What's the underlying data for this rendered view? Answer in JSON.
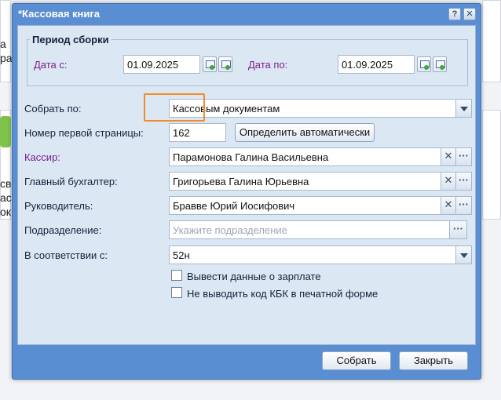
{
  "dialog": {
    "title": "*Кассовая книга",
    "help_button": "?",
    "close_button": "✕"
  },
  "period": {
    "legend": "Период сборки",
    "date_from_label": "Дата с:",
    "date_from_value": "01.09.2025",
    "date_to_label": "Дата по:",
    "date_to_value": "01.09.2025"
  },
  "form": {
    "collect_by_label": "Собрать по:",
    "collect_by_value": "Кассовым документам",
    "first_page_label": "Номер первой страницы:",
    "first_page_value": "162",
    "auto_detect_button": "Определить автоматически",
    "cashier_label": "Кассир:",
    "cashier_value": "Парамонова Галина Васильевна",
    "chief_accountant_label": "Главный бухгалтер:",
    "chief_accountant_value": "Григорьева Галина Юрьевна",
    "manager_label": "Руководитель:",
    "manager_value": "Бравве Юрий Иосифович",
    "department_label": "Подразделение:",
    "department_placeholder": "Укажите подразделение",
    "according_label": "В соответствии с:",
    "according_value": "52н",
    "salary_checkbox_label": "Вывести данные о зарплате",
    "kbk_checkbox_label": "Не выводить код КБК в печатной форме",
    "clear_symbol": "✕",
    "ellipsis_symbol": "···"
  },
  "footer": {
    "collect_button": "Собрать",
    "close_button": "Закрыть"
  },
  "background": {
    "left_fragments": [
      "а",
      "раз",
      "све",
      "ас",
      "ок"
    ]
  },
  "colors": {
    "window_frame": "#5a8ed3",
    "body_background": "#dce7f4",
    "label_purple": "#7c1f8a",
    "highlight_orange": "#f28c28"
  }
}
